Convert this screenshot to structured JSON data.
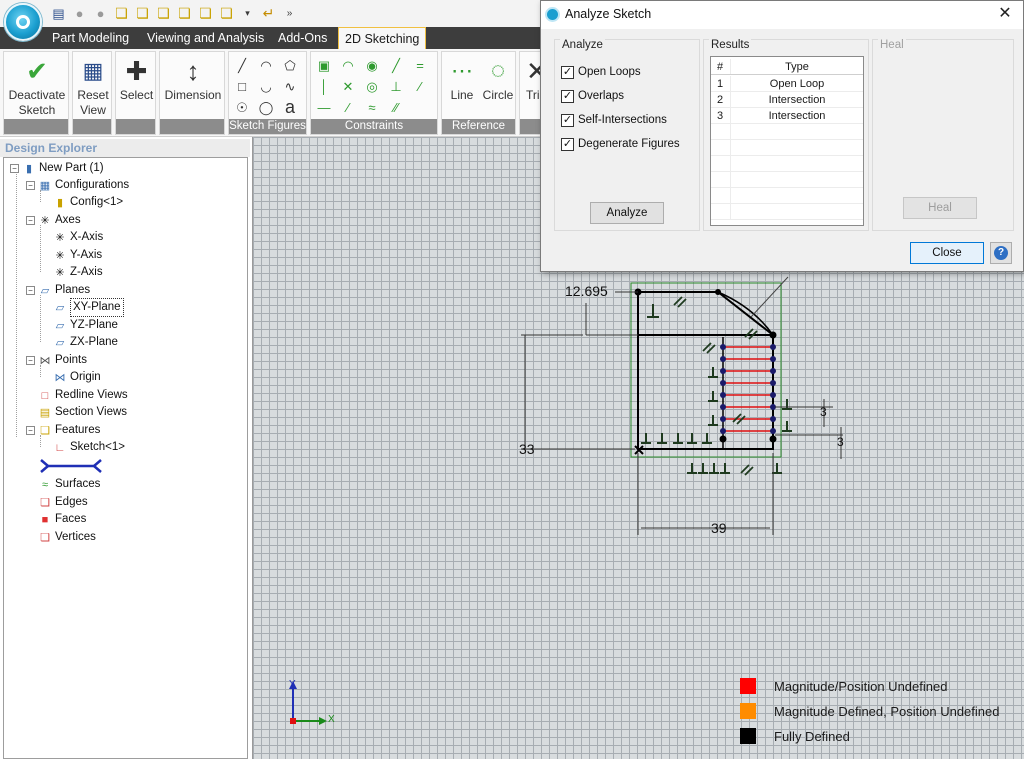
{
  "quick_access": {
    "icons": [
      "app-menu-icon",
      "save-icon",
      "circle-icon",
      "circle-icon",
      "cube-icon",
      "cube-icon",
      "cube-icon",
      "cube-icon",
      "cube-icon",
      "cube-icon",
      "dropdown-icon",
      "undo-icon",
      "more-icon"
    ]
  },
  "tabs": [
    {
      "label": "Part Modeling",
      "active": false
    },
    {
      "label": "Viewing and Analysis",
      "active": false
    },
    {
      "label": "Add-Ons",
      "active": false
    },
    {
      "label": "2D Sketching",
      "active": true
    }
  ],
  "ribbon": {
    "deactivate_label1": "Deactivate",
    "deactivate_label2": "Sketch",
    "reset_label1": "Reset",
    "reset_label2": "View",
    "select_label": "Select",
    "dimension_label": "Dimension",
    "sketch_figures_title": "Sketch Figures",
    "constraints_title": "Constraints",
    "reference_title": "Reference",
    "line_label": "Line",
    "circle_label": "Circle",
    "trim_label": "Tri",
    "text_tool": "a"
  },
  "explorer": {
    "title": "Design Explorer",
    "nodes": {
      "new_part": "New Part (1)",
      "configurations": "Configurations",
      "config1": "Config<1>",
      "axes": "Axes",
      "x_axis": "X-Axis",
      "y_axis": "Y-Axis",
      "z_axis": "Z-Axis",
      "planes": "Planes",
      "xy_plane": "XY-Plane",
      "yz_plane": "YZ-Plane",
      "zx_plane": "ZX-Plane",
      "points": "Points",
      "origin": "Origin",
      "redline_views": "Redline Views",
      "section_views": "Section Views",
      "features": "Features",
      "sketch1": "Sketch<1>",
      "surfaces": "Surfaces",
      "edges": "Edges",
      "faces": "Faces",
      "vertices": "Vertices"
    }
  },
  "canvas": {
    "dimensions": {
      "top_width": "12.695",
      "height": "33",
      "bottom_width": "39",
      "right_small_1": "3",
      "right_small_2": "3"
    },
    "triad": {
      "x": "X",
      "y": "Y"
    },
    "legend": [
      {
        "label": "Magnitude/Position Undefined",
        "color": "#ff0000"
      },
      {
        "label": "Magnitude Defined, Position Undefined",
        "color": "#ff8c00"
      },
      {
        "label": "Fully Defined",
        "color": "#000000"
      }
    ]
  },
  "dialog": {
    "title": "Analyze Sketch",
    "analyze_panel_title": "Analyze",
    "checkboxes": [
      {
        "label": "Open Loops",
        "checked": true
      },
      {
        "label": "Overlaps",
        "checked": true
      },
      {
        "label": "Self-Intersections",
        "checked": true
      },
      {
        "label": "Degenerate Figures",
        "checked": true
      }
    ],
    "analyze_button": "Analyze",
    "results_title": "Results",
    "results_headers": {
      "num": "#",
      "type": "Type"
    },
    "results_rows": [
      {
        "num": "1",
        "type": "Open Loop"
      },
      {
        "num": "2",
        "type": "Intersection"
      },
      {
        "num": "3",
        "type": "Intersection"
      }
    ],
    "heal_title": "Heal",
    "heal_button": "Heal",
    "close_button": "Close"
  }
}
